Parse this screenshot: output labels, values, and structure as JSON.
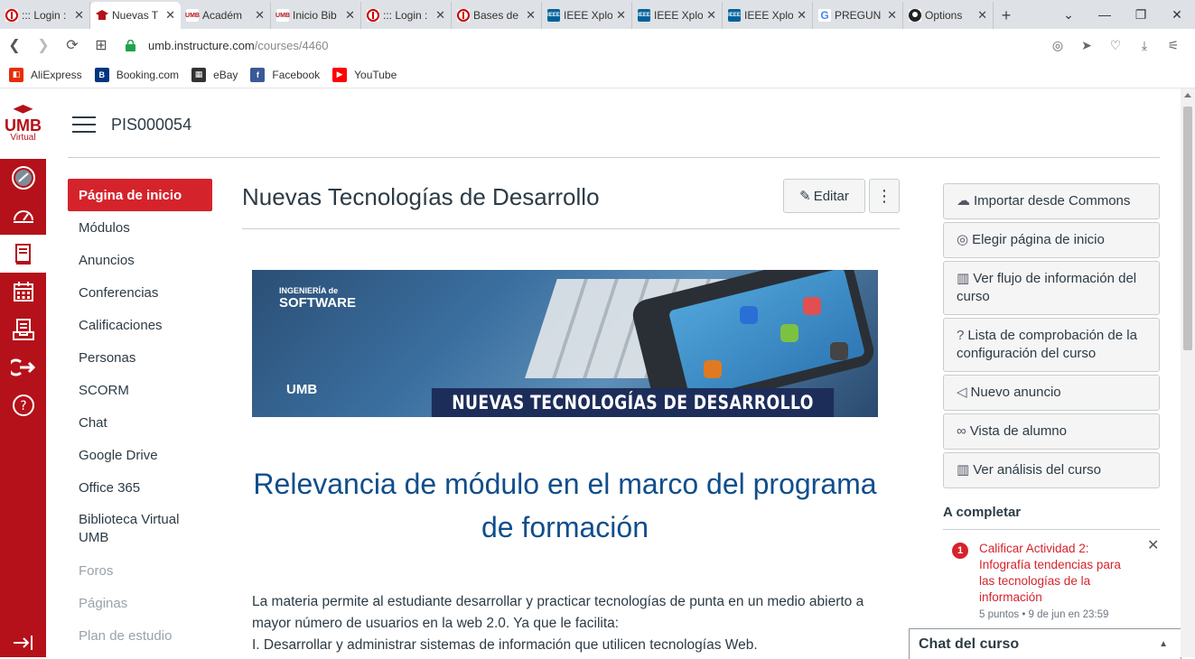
{
  "browser": {
    "tabs": [
      {
        "title": "::: Login :",
        "favicon": "umb",
        "active": false
      },
      {
        "title": "Nuevas T",
        "favicon": "umb-cap",
        "active": true
      },
      {
        "title": "Académ",
        "favicon": "umb-text",
        "active": false
      },
      {
        "title": "Inicio Bib",
        "favicon": "umb-text",
        "active": false
      },
      {
        "title": "::: Login :",
        "favicon": "umb",
        "active": false
      },
      {
        "title": "Bases de",
        "favicon": "umb",
        "active": false
      },
      {
        "title": "IEEE Xplo",
        "favicon": "ieee",
        "active": false
      },
      {
        "title": "IEEE Xplo",
        "favicon": "ieee",
        "active": false
      },
      {
        "title": "IEEE Xplo",
        "favicon": "ieee",
        "active": false
      },
      {
        "title": "PREGUN",
        "favicon": "google",
        "active": false
      },
      {
        "title": "Options",
        "favicon": "github",
        "active": false
      }
    ],
    "url_host": "umb.instructure.com",
    "url_path": "/courses/4460",
    "bookmarks": [
      {
        "label": "AliExpress",
        "color": "#e62e04"
      },
      {
        "label": "Booking.com",
        "color": "#003580"
      },
      {
        "label": "eBay",
        "color": "#333333"
      },
      {
        "label": "Facebook",
        "color": "#3b5998"
      },
      {
        "label": "YouTube",
        "color": "#ff0000"
      }
    ]
  },
  "course": {
    "code": "PIS000054",
    "nav": [
      {
        "label": "Página de inicio",
        "state": "active"
      },
      {
        "label": "Módulos",
        "state": "normal"
      },
      {
        "label": "Anuncios",
        "state": "normal"
      },
      {
        "label": "Conferencias",
        "state": "normal"
      },
      {
        "label": "Calificaciones",
        "state": "normal"
      },
      {
        "label": "Personas",
        "state": "normal"
      },
      {
        "label": "SCORM",
        "state": "normal"
      },
      {
        "label": "Chat",
        "state": "normal"
      },
      {
        "label": "Google Drive",
        "state": "normal"
      },
      {
        "label": "Office 365",
        "state": "normal"
      },
      {
        "label": "Biblioteca Virtual UMB",
        "state": "normal"
      },
      {
        "label": "Foros",
        "state": "muted"
      },
      {
        "label": "Páginas",
        "state": "muted"
      },
      {
        "label": "Plan de estudio",
        "state": "muted"
      }
    ]
  },
  "main": {
    "title": "Nuevas Tecnologías de Desarrollo",
    "edit_label": "Editar",
    "banner": {
      "caption": "NUEVAS TECNOLOGÍAS DE DESARROLLO",
      "software_line1": "INGENIERÍA de",
      "software_line2": "SOFTWARE",
      "umb_mark": "UMB"
    },
    "heading": "Relevancia de módulo en el marco del programa de formación",
    "paragraph_lines": [
      "La materia permite al estudiante desarrollar y practicar tecnologías de punta en un medio abierto a",
      "mayor número de usuarios en la web 2.0. Ya que le facilita:",
      "I. Desarrollar y administrar sistemas de información que utilicen tecnologías Web."
    ]
  },
  "sidebar": {
    "buttons": [
      {
        "label": "Importar desde Commons",
        "icon": "cloud-icon"
      },
      {
        "label": "Elegir página de inicio",
        "icon": "target-icon"
      },
      {
        "label": "Ver flujo de información del curso",
        "icon": "chart-icon"
      },
      {
        "label": "Lista de comprobación de la configuración del curso",
        "icon": "question-icon"
      },
      {
        "label": "Nuevo anuncio",
        "icon": "megaphone-icon"
      },
      {
        "label": "Vista de alumno",
        "icon": "glasses-icon"
      },
      {
        "label": "Ver análisis del curso",
        "icon": "chart-icon"
      }
    ],
    "todo": {
      "title": "A completar",
      "badge": "1",
      "item": "Calificar Actividad 2: Infografía tendencias para las tecnologías de la información",
      "meta": "5 puntos • 9 de jun en 23:59"
    }
  },
  "chat": {
    "title": "Chat del curso"
  },
  "colors": {
    "brand": "#b5111a",
    "active_nav": "#d5232c",
    "heading": "#104e8b"
  }
}
